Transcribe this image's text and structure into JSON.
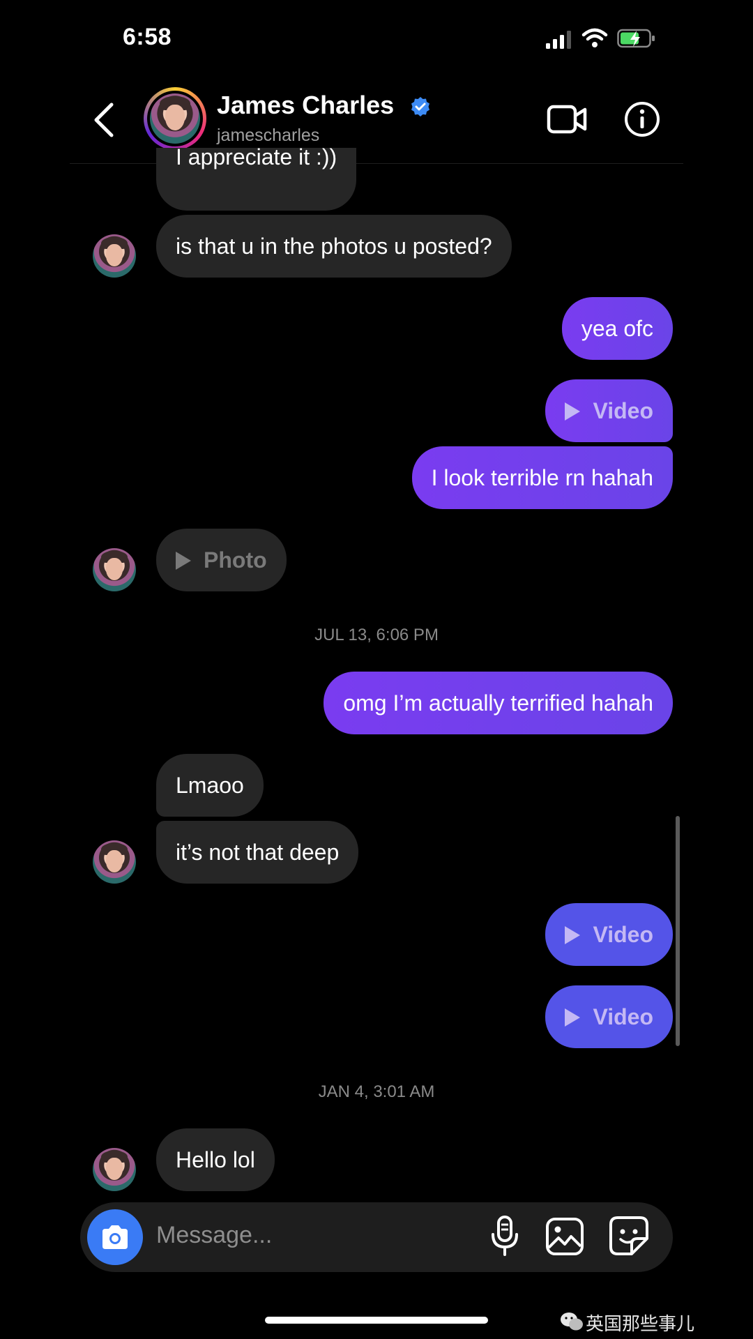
{
  "status_bar": {
    "time": "6:58"
  },
  "header": {
    "name": "James Charles",
    "handle": "jamescharles",
    "back_icon": "chevron-left-icon",
    "verified_icon": "verified-badge-icon",
    "video_call_icon": "video-camera-icon",
    "info_icon": "info-icon"
  },
  "messages": [
    {
      "dir": "in",
      "text": "I appreciate it :))"
    },
    {
      "dir": "in",
      "text": "is that u in the photos u posted?"
    },
    {
      "dir": "out",
      "text": "yea ofc"
    },
    {
      "dir": "out",
      "text": "Video"
    },
    {
      "dir": "out",
      "text": "I look terrible rn hahah"
    },
    {
      "dir": "in",
      "text": "Photo"
    },
    {
      "dir": "out",
      "text": "omg I’m actually terrified hahah"
    },
    {
      "dir": "in",
      "text": "Lmaoo"
    },
    {
      "dir": "in",
      "text": "it’s not that deep"
    },
    {
      "dir": "out",
      "text": "Video"
    },
    {
      "dir": "out",
      "text": "Video"
    },
    {
      "dir": "in",
      "text": "Hello lol"
    }
  ],
  "timestamps": [
    "JUL 13, 6:06 PM",
    "JAN 4, 3:01 AM"
  ],
  "composer": {
    "placeholder": "Message...",
    "camera_icon": "camera-icon",
    "mic_icon": "microphone-icon",
    "gallery_icon": "image-gallery-icon",
    "sticker_icon": "sticker-icon"
  },
  "watermark": "英国那些事儿",
  "colors": {
    "outgoing": "#7a3cf0",
    "outgoing_blue": "#5454e8",
    "incoming": "#262626",
    "accent": "#3a7bf5"
  }
}
